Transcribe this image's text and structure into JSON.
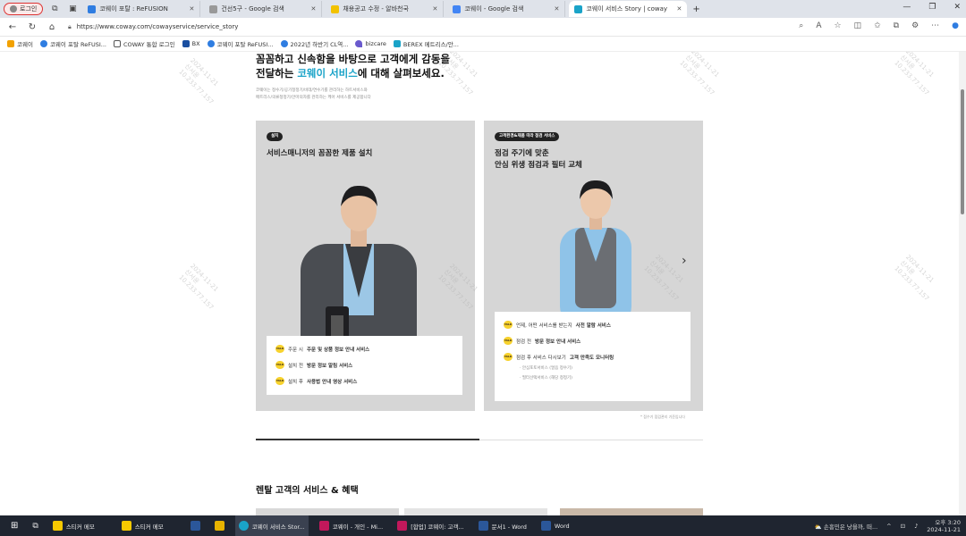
{
  "browser": {
    "profile_label": "로그인",
    "tabs": [
      {
        "title": "코웨이 포탈 : ReFUSION",
        "color": "#2f7de1"
      },
      {
        "title": "건선5구 - Google 검색",
        "color": "#999999"
      },
      {
        "title": "채용공고 수정 - 알바천국",
        "color": "#f2c200"
      },
      {
        "title": "코웨이 - Google 검색",
        "color": "#4285f4"
      },
      {
        "title": "코웨이 서비스 Story | coway",
        "color": "#1aa3c8"
      }
    ],
    "url": "https://www.coway.com/cowayservice/service_story",
    "bookmarks": [
      {
        "label": "코웨이",
        "color": "#f2a100"
      },
      {
        "label": "코웨이 포탈 ReFUSI...",
        "color": "#2f7de1"
      },
      {
        "label": "COWAY 통합 로그인",
        "color": "#555555"
      },
      {
        "label": "BX",
        "color": "#1a4fa0"
      },
      {
        "label": "코웨이 포탈 ReFUSI...",
        "color": "#2f7de1"
      },
      {
        "label": "2022년 하반기 CL역...",
        "color": "#2f7de1"
      },
      {
        "label": "bizcare",
        "color": "#6a5acd"
      },
      {
        "label": "BEREX 메트리스/안...",
        "color": "#1aa3c8"
      }
    ]
  },
  "page": {
    "hero_line1": "꼼꼼하고 신속함을 바탕으로 고객에게 감동을",
    "hero_line2_prefix": "전달하는 ",
    "hero_line2_highlight": "코웨이 서비스",
    "hero_line2_suffix": "에 대해 살펴보세요.",
    "hero_sub1": "코웨이는 정수기/공기청정기/비데/연수기를 관리하는 하트서비스와",
    "hero_sub2": "메트리스/의류청정기/안마의자를 관리하는 케어 서비스를 제공합니다",
    "cards": [
      {
        "badge": "설치",
        "title": "서비스매니저의 꼼꼼한 제품 설치",
        "items": [
          {
            "pre": "주문 시 ",
            "bold": "주문 및 상품 정보 안내 서비스"
          },
          {
            "pre": "설치 전 ",
            "bold": "방문 정보 알림 서비스"
          },
          {
            "pre": "설치 후 ",
            "bold": "사용법 안내 영상 서비스"
          }
        ]
      },
      {
        "badge": "고객환경&제품 따라 점검 서비스",
        "title_line1": "점검 주기에 맞춘",
        "title_line2": "안심 위생 점검과 필터 교체",
        "items": [
          {
            "pre": "언제, 어떤 서비스를 받는지 ",
            "bold": "사전 알람 서비스"
          },
          {
            "pre": "점검 전 ",
            "bold": "방문 정보 안내 서비스"
          },
          {
            "pre": "점검 후 서비스 다시보기 ",
            "bold": "고객 만족도 모니터링"
          }
        ],
        "subitems": [
          "· 안심포토서비스 (얼음 정수기)",
          "· 필터선택서비스 (해당 청정기)"
        ]
      }
    ],
    "card_note": "* 점수기 점검관리 기준입니다",
    "section_title": "렌탈 고객의 서비스 & 혜택",
    "watermark_line1": "2024-11-21",
    "watermark_line2": "신서윤",
    "watermark_line3": "10.233.77.157"
  },
  "taskbar": {
    "items": [
      {
        "label": "스티커 메모",
        "color": "#f7c900"
      },
      {
        "label": "스티커 메모",
        "color": "#f7c900"
      },
      {
        "label": "",
        "color": "#2b579a"
      },
      {
        "label": "",
        "color": "#e8b400"
      },
      {
        "label": "코웨이 서비스 Stor...",
        "color": "#1aa3c8"
      },
      {
        "label": "코웨이 - 개인 - Mi...",
        "color": "#c2185b"
      },
      {
        "label": "[합업] 코웨이: 고객...",
        "color": "#c2185b"
      },
      {
        "label": "문서1 - Word",
        "color": "#2b579a"
      },
      {
        "label": "Word",
        "color": "#2b579a"
      }
    ],
    "weather": "손흥민은 낭을까, 떠...",
    "time": "오후 3:20",
    "date": "2024-11-21"
  }
}
